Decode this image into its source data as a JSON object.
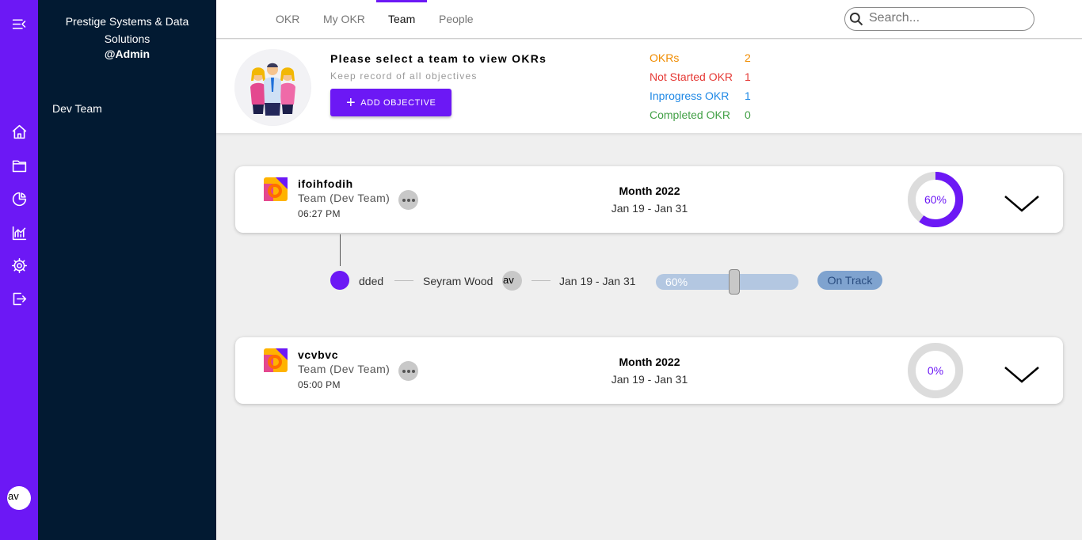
{
  "rail": {
    "icons": [
      "menu-collapse-icon",
      "home-icon",
      "folder-icon",
      "pie-chart-icon",
      "analytics-icon",
      "settings-icon",
      "logout-icon"
    ],
    "avatar": "av",
    "accent": "#6c18f5"
  },
  "sidebar": {
    "org_line1": "Prestige Systems & Data",
    "org_line2": "Solutions",
    "role": "@Admin",
    "team_item": "Dev Team",
    "background": "#021a32"
  },
  "nav": {
    "tabs": [
      "OKR",
      "My OKR",
      "Team",
      "People"
    ],
    "active_tab": "Team",
    "search_placeholder": "Search..."
  },
  "header": {
    "title": "Please select a team to view OKRs",
    "subtitle": "Keep record of all objectives",
    "add_button": "ADD OBJECTIVE",
    "stats": [
      {
        "label": "OKRs",
        "value": "2",
        "color": "#f08c00"
      },
      {
        "label": "Not Started OKR",
        "value": "1",
        "color": "#e53935"
      },
      {
        "label": "Inprogress OKR",
        "value": "1",
        "color": "#1e88e5"
      },
      {
        "label": "Completed OKR",
        "value": "0",
        "color": "#43a047"
      }
    ]
  },
  "objectives": [
    {
      "name": "ifoihfodih",
      "team": "Team (Dev Team)",
      "time": "06:27 PM",
      "period": "Month 2022",
      "range": "Jan 19 - Jan 31",
      "progress_label": "60%",
      "progress": 60
    },
    {
      "name": "vcvbvc",
      "team": "Team (Dev Team)",
      "time": "05:00 PM",
      "period": "Month 2022",
      "range": "Jan 19 - Jan 31",
      "progress_label": "0%",
      "progress": 0
    }
  ],
  "key_result": {
    "name": "dded",
    "owner": "Seyram Wood",
    "owner_avatar": "av",
    "range": "Jan 19 - Jan 31",
    "progress_label": "60%",
    "progress": 60,
    "status": "On Track"
  }
}
